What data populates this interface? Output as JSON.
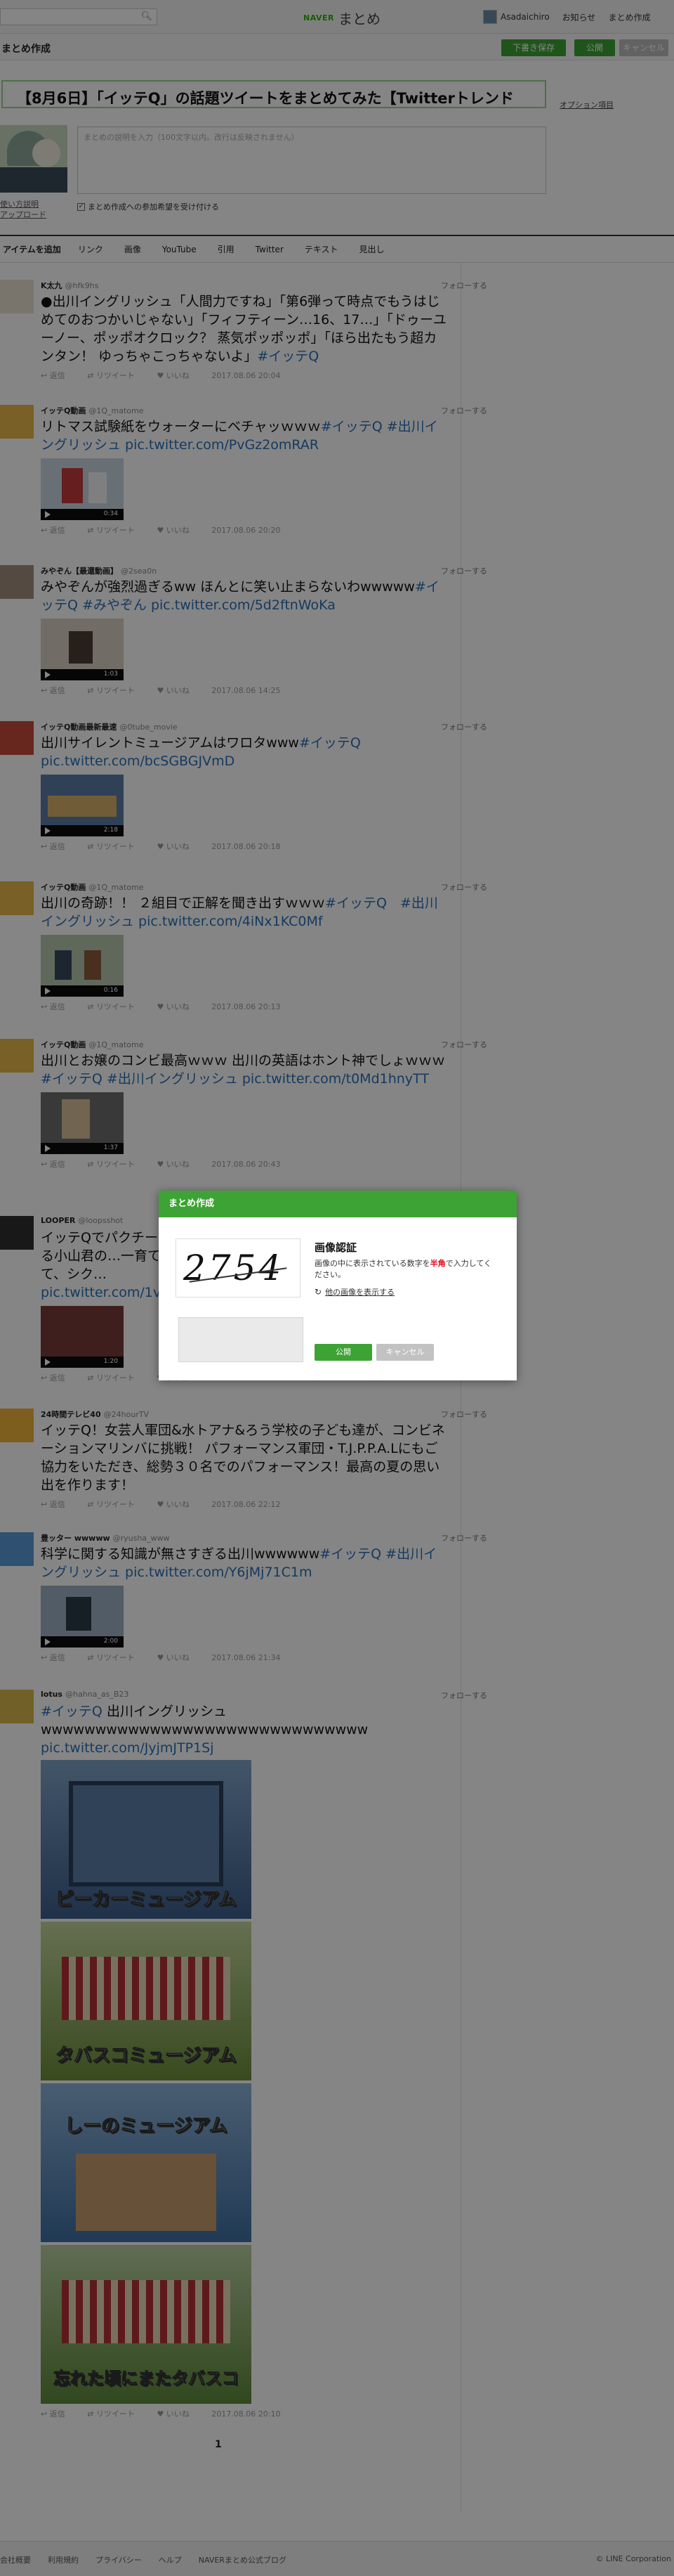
{
  "topbar": {
    "logo_naver": "NAVER",
    "logo_matome": "まとめ",
    "user_name": "Asadaichiro",
    "notifications": "お知らせ",
    "create": "まとめ作成"
  },
  "edit": {
    "heading": "まとめ作成",
    "draft_button": "下書き保存",
    "publish_button": "公開",
    "cancel_button": "キャンセル",
    "title": "【8月6日】「イッテQ」の話題ツイートをまとめてみた【Twitterトレンド",
    "option_link": "オプション項目",
    "description_placeholder": "まとめの説明を入力（100文字以内。改行は反映されません）",
    "thumb_delete": "使い方説明",
    "thumb_upload": "アップロード",
    "accept_label": "まとめ作成への参加希望を受け付ける"
  },
  "toolbar": {
    "label": "アイテムを追加",
    "items": [
      "リンク",
      "画像",
      "YouTube",
      "引用",
      "Twitter",
      "テキスト",
      "見出し"
    ]
  },
  "follow_label": "フォローする",
  "action_labels": {
    "reply": "返信",
    "retweet": "リツイート",
    "like": "いいね"
  },
  "tweets": [
    {
      "name": "K太九",
      "handle": "@hfk9hs",
      "text": "●出川イングリッシュ「人間力ですね」「第6弾って時点でもうはじめてのおつかいじゃない」「フィフティーン…16、17…」「ドゥーユーノー、ポッポオクロック？ 蒸気ポッポッポ」「ほら出たもう超カンタン！ ゆっちゃこっちゃないよ」",
      "tags": "#イッテQ",
      "time": "2017.08.06 20:04"
    },
    {
      "name": "イッテQ動画",
      "handle": "@1Q_matome",
      "text": "リトマス試験紙をウォーターにベチャッｗｗｗ",
      "tags": "#イッテQ #出川イングリッシュ pic.twitter.com/PvGz2omRAR",
      "duration": "0:34",
      "time": "2017.08.06 20:20"
    },
    {
      "name": "みやぞん【最還動画】",
      "handle": "@2sea0n",
      "text": "みやぞんが強烈過ぎるww ほんとに笑い止まらないわwwwww",
      "tags": "#イッテQ #みやぞん pic.twitter.com/5d2ftnWoKa",
      "duration": "1:03",
      "time": "2017.08.06 14:25"
    },
    {
      "name": "イッテQ動画最新最速",
      "handle": "@0tube_movie",
      "text": "出川サイレントミュージアムはワロタwww",
      "tags": "#イッテQ pic.twitter.com/bcSGBGJVmD",
      "duration": "2:18",
      "time": "2017.08.06 20:18"
    },
    {
      "name": "イッテQ動画",
      "handle": "@1Q_matome",
      "text": "出川の奇跡！！ ２組目で正解を聞き出すｗｗｗ",
      "tags": "#イッテQ　#出川イングリッシュ pic.twitter.com/4iNx1KC0Mf",
      "duration": "0:16",
      "time": "2017.08.06 20:13"
    },
    {
      "name": "イッテQ動画",
      "handle": "@1Q_matome",
      "text": "出川とお嬢のコンビ最高ｗｗｗ 出川の英語はホント神でしょｗｗｗ",
      "tags": "#イッテQ #出川イングリッシュ pic.twitter.com/t0Md1hnyTT",
      "duration": "1:37",
      "time": "2017.08.06 20:43"
    },
    {
      "name": "LOOPER",
      "handle": "@loopsshot",
      "text": "イッテQでパクチー…食べる小山君の…一育てるって、シク…",
      "tags": "pic.twitter.com/1vT…",
      "duration": "1:20",
      "time": "2017.08.06 20:13"
    },
    {
      "name": "24時間テレビ40",
      "handle": "@24hourTV",
      "text": "イッテQ！女芸人軍団&水トアナ&ろう学校の子ども達が、コンビネーションマリンバに挑戦！ パフォーマンス軍団・T.J.P.P.A.Lにもご協力をいただき、総勢３０名でのパフォーマンス！最高の夏の思い出を作ります！",
      "tags": "",
      "time": "2017.08.06 22:12"
    },
    {
      "name": "豊ッター wwwww",
      "handle": "@ryusha_www",
      "text": "科学に関する知識が無さすぎる出川wwwwww",
      "tags": "#イッテQ #出川イングリッシュ pic.twitter.com/Y6jMj71C1m",
      "duration": "2:00",
      "time": "2017.08.06 21:34"
    },
    {
      "name": "lotus",
      "handle": "@hahna_as_B23",
      "text": "出川イングリッシュ wwwwwwwwwwwwwwwwwwwwwwwwwwwwww",
      "tags_pre": "#イッテQ",
      "tags": "pic.twitter.com/JyjmJTP1Sj",
      "images": [
        "ピーカーミュージアム",
        "タバスコミュージアム",
        "しーのミュージアム",
        "忘れた頃にまたタバスコ"
      ],
      "time": "2017.08.06 20:10"
    }
  ],
  "pager": "1",
  "footer": {
    "links": [
      "会社概要",
      "利用規約",
      "プライバシー",
      "ヘルプ",
      "NAVERまとめ公式ブログ"
    ],
    "copyright": "© LINE Corporation"
  },
  "modal": {
    "header": "まとめ作成",
    "captcha_digits": "2754",
    "title": "画像認証",
    "desc_pre": "画像の中に表示されている数字を",
    "desc_red": "半角",
    "desc_post": "で入力してください。",
    "other_image": "他の画像を表示する",
    "publish": "公開",
    "cancel": "キャンセル"
  },
  "colors": {
    "accent": "#3da334",
    "link": "#2a6fb7",
    "warning": "#e60012"
  }
}
